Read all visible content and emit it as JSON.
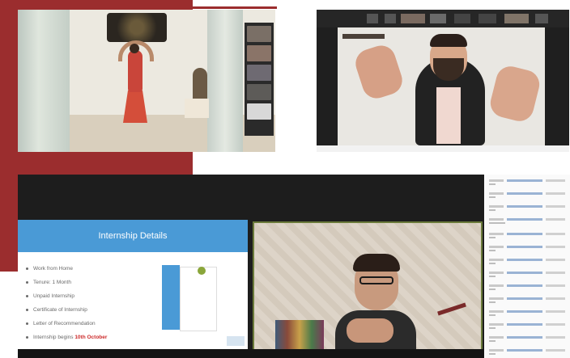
{
  "colors": {
    "accent_red": "#9b2d2e",
    "slide_blue": "#4a9ad6",
    "date_highlight": "#cc2a2a"
  },
  "slide": {
    "title": "Internship Details",
    "items": [
      {
        "text": "Work from Home"
      },
      {
        "text": "Tenure: 1 Month"
      },
      {
        "text": "Unpaid Internship"
      },
      {
        "text": "Certificate of Internship"
      },
      {
        "text": "Letter of Recommendation"
      }
    ],
    "last_item": {
      "prefix": "Internship begins ",
      "date": "10th October"
    }
  },
  "icons": [
    "mandala-art-icon",
    "brass-lamp-icon",
    "telescope-icon",
    "bookshelf-icon"
  ]
}
